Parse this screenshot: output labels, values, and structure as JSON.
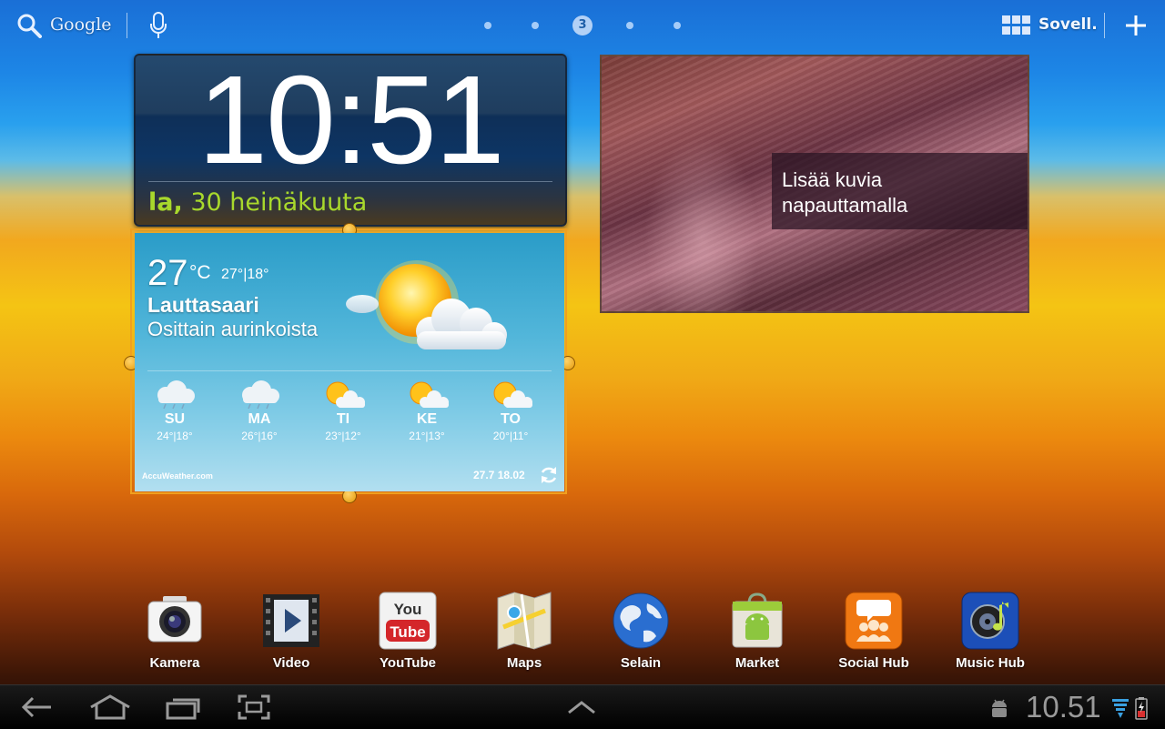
{
  "topbar": {
    "search_label": "Google",
    "page_indicator": "3",
    "apps_label": "Sovell."
  },
  "clock": {
    "time": "10:51",
    "day": "la,",
    "date": "30 heinäkuuta"
  },
  "weather": {
    "temp": "27",
    "unit": "°C",
    "hilo": "27°|18°",
    "location": "Lauttasaari",
    "condition": "Osittain aurinkoista",
    "forecast": [
      {
        "day": "SU",
        "temps": "24°|18°",
        "icon": "cloud-rain-icon"
      },
      {
        "day": "MA",
        "temps": "26°|16°",
        "icon": "cloud-rain-icon"
      },
      {
        "day": "TI",
        "temps": "23°|12°",
        "icon": "partly-sunny-icon"
      },
      {
        "day": "KE",
        "temps": "21°|13°",
        "icon": "partly-sunny-icon"
      },
      {
        "day": "TO",
        "temps": "20°|11°",
        "icon": "partly-sunny-icon"
      }
    ],
    "provider": "AccuWeather.com",
    "updated": "27.7 18.02"
  },
  "photo": {
    "caption_line1": "Lisää kuvia",
    "caption_line2": "napauttamalla"
  },
  "dock": [
    {
      "label": "Kamera",
      "icon": "camera-icon"
    },
    {
      "label": "Video",
      "icon": "video-icon"
    },
    {
      "label": "YouTube",
      "icon": "youtube-icon"
    },
    {
      "label": "Maps",
      "icon": "maps-icon"
    },
    {
      "label": "Selain",
      "icon": "globe-icon"
    },
    {
      "label": "Market",
      "icon": "market-icon"
    },
    {
      "label": "Social Hub",
      "icon": "social-hub-icon"
    },
    {
      "label": "Music Hub",
      "icon": "music-hub-icon"
    }
  ],
  "navbar": {
    "time": "10.51"
  },
  "colors": {
    "accent_date": "#a8d82c",
    "selection": "#f0a020"
  }
}
